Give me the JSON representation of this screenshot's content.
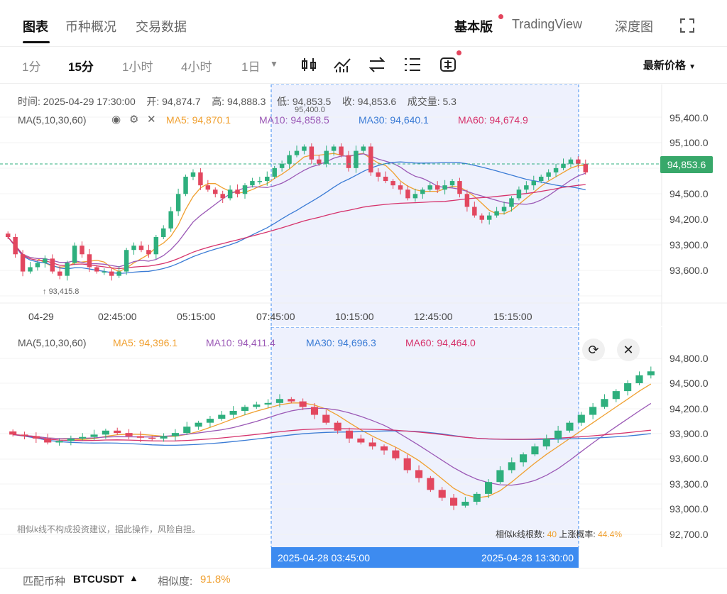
{
  "tabs": {
    "items": [
      "图表",
      "币种概况",
      "交易数据"
    ],
    "right": [
      "基本版",
      "TradingView",
      "深度图"
    ]
  },
  "toolbar": {
    "intervals": [
      "1分",
      "15分",
      "1小时",
      "4小时",
      "1日"
    ],
    "price_mode": "最新价格"
  },
  "ohlc": {
    "time_label": "时间:",
    "time": "2025-04-29 17:30:00",
    "open_label": "开:",
    "open": "94,874.7",
    "high_label": "高:",
    "high": "94,888.3",
    "low_label": "低:",
    "low": "94,853.5",
    "close_label": "收:",
    "close": "94,853.6",
    "vol_label": "成交量:",
    "vol": "5.3"
  },
  "main_ma": {
    "label": "MA(5,10,30,60)",
    "ma5": "MA5: 94,870.1",
    "ma10": "MA10: 94,858.5",
    "ma30": "MA30: 94,640.1",
    "ma60": "MA60: 94,674.9"
  },
  "main_axis": {
    "prices": [
      "95,400.0",
      "95,100.0",
      "94,500.0",
      "94,200.0",
      "93,900.0",
      "93,600.0"
    ],
    "times": [
      "04-29",
      "02:45:00",
      "05:15:00",
      "07:45:00",
      "10:15:00",
      "12:45:00",
      "15:15:00"
    ],
    "last_price": "94,853.6",
    "high_mark": "95,400.0",
    "low_mark": "93,415.8"
  },
  "sub_ma": {
    "label": "MA(5,10,30,60)",
    "ma5": "MA5: 94,396.1",
    "ma10": "MA10: 94,411.4",
    "ma30": "MA30: 94,696.3",
    "ma60": "MA60: 94,464.0"
  },
  "sub_axis": {
    "prices": [
      "94,800.0",
      "94,500.0",
      "94,200.0",
      "93,900.0",
      "93,600.0",
      "93,300.0",
      "93,000.0",
      "92,700.0"
    ]
  },
  "disclaimer": "相似k线不构成投资建议，据此操作，风险自担。",
  "similar": {
    "count_label": "相似k线根数:",
    "count": "40",
    "prob_label": "上涨概率:",
    "prob": "44.4%"
  },
  "range": {
    "start": "2025-04-28 03:45:00",
    "end": "2025-04-28 13:30:00"
  },
  "footer": {
    "match_label": "匹配币种",
    "symbol": "BTCUSDT",
    "sim_label": "相似度:",
    "sim": "91.8%"
  },
  "colors": {
    "up": "#2eaf7d",
    "down": "#e2475f",
    "ma5": "#f0a030",
    "ma10": "#9b59b6",
    "ma30": "#3a7bd5",
    "ma60": "#d6336c",
    "highlight": "#eef1fd",
    "accent": "#3d8bf0"
  },
  "chart_data": [
    {
      "type": "candlestick",
      "title": "",
      "x_ticks": [
        "04-29",
        "02:45:00",
        "05:15:00",
        "07:45:00",
        "10:15:00",
        "12:45:00",
        "15:15:00"
      ],
      "ylim": [
        93400,
        95500
      ],
      "close": [
        94100,
        93900,
        93700,
        93750,
        93800,
        93850,
        93700,
        93650,
        93800,
        94000,
        93900,
        93750,
        93700,
        93700,
        93650,
        93700,
        93950,
        94000,
        93950,
        93900,
        94100,
        94200,
        94400,
        94600,
        94800,
        94850,
        94700,
        94650,
        94600,
        94550,
        94650,
        94600,
        94700,
        94750,
        94750,
        94800,
        94900,
        94950,
        95050,
        95100,
        95150,
        95000,
        94950,
        95100,
        95150,
        95050,
        94900,
        95100,
        95150,
        94850,
        94800,
        94750,
        94700,
        94650,
        94550,
        94600,
        94650,
        94700,
        94650,
        94700,
        94750,
        94600,
        94450,
        94350,
        94300,
        94350,
        94400,
        94450,
        94550,
        94650,
        94700,
        94750,
        94800,
        94850,
        94900,
        94950,
        95000,
        94950,
        94850
      ]
    },
    {
      "type": "candlestick",
      "title": "",
      "ylim": [
        92700,
        94900
      ],
      "close": [
        93900,
        93880,
        93850,
        93800,
        93820,
        93850,
        93870,
        93900,
        93950,
        93920,
        93880,
        93860,
        93850,
        93880,
        93920,
        94000,
        94050,
        94100,
        94150,
        94200,
        94250,
        94280,
        94300,
        94350,
        94320,
        94250,
        94150,
        94050,
        93950,
        93850,
        93800,
        93750,
        93700,
        93600,
        93450,
        93350,
        93200,
        93100,
        93000,
        93050,
        93150,
        93300,
        93450,
        93550,
        93650,
        93750,
        93850,
        93950,
        94050,
        94150,
        94250,
        94350,
        94450,
        94550,
        94650,
        94700
      ]
    }
  ]
}
